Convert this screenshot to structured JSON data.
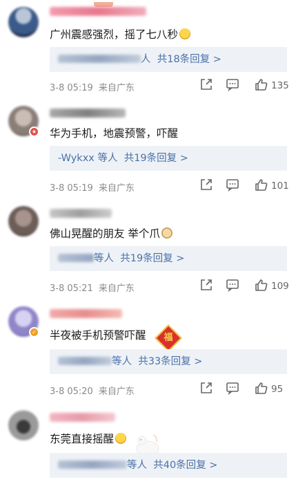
{
  "comments": [
    {
      "text": "广州震感强烈，摇了七八秒",
      "reply_suffix": "人",
      "reply_count": "共18条回复 >",
      "date": "3-8 05:19",
      "location": "来自广东",
      "likes": "135",
      "avatar_color": "#3b5a8a",
      "name_color": "#e3607a"
    },
    {
      "text": "华为手机，地震预警，吓醒",
      "reply_names": "-Wykxx 等人",
      "reply_count": "共19条回复 >",
      "date": "3-8 05:19",
      "location": "来自广东",
      "likes": "101",
      "avatar_color": "#9a8f86",
      "name_color": "#7a7a7a"
    },
    {
      "text": "佛山晃醒的朋友 举个爪",
      "reply_suffix": "等人",
      "reply_count": "共19条回复 >",
      "date": "3-8 05:21",
      "location": "来自广东",
      "likes": "109",
      "avatar_color": "#6b5d58",
      "name_color": "#9a9a9a"
    },
    {
      "text": "半夜被手机预警吓醒",
      "reply_suffix": "等人",
      "reply_count": "共33条回复 >",
      "date": "3-8 05:20",
      "location": "来自广东",
      "likes": "95",
      "avatar_color": "#8f86c9",
      "name_color": "#e37a7a",
      "sticker_text": "福"
    },
    {
      "text": "东莞直接摇醒",
      "reply_suffix": "等人",
      "reply_count": "共40条回复 >",
      "avatar_color": "#7a7a7a",
      "name_color": "#e38a9a"
    }
  ]
}
